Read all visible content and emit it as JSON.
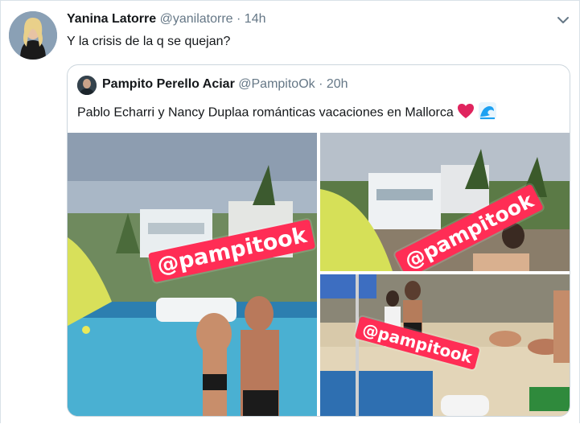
{
  "tweet": {
    "author_name": "Yanina Latorre",
    "author_handle": "@yanilatorre",
    "separator": "·",
    "time": "14h",
    "text": "Y la crisis de la q se quejan?"
  },
  "quoted_tweet": {
    "author_name": "Pampito Perello Aciar",
    "author_handle": "@PampitoOk",
    "separator": "·",
    "time": "20h",
    "text": "Pablo Echarri y Nancy Duplaa románticas vacaciones en Mallorca",
    "emojis": [
      "heart-emoji",
      "wave-emoji"
    ]
  },
  "media": {
    "watermark": "@pampitook",
    "images": [
      "couple-in-sea-photo",
      "villa-and-umbrella-photo",
      "beach-crowd-photo"
    ]
  },
  "colors": {
    "watermark_bg": "#ff2d55",
    "heart": "#e0245e",
    "wave": "#1da1f2"
  },
  "icons": {
    "menu": "chevron-down-icon"
  }
}
